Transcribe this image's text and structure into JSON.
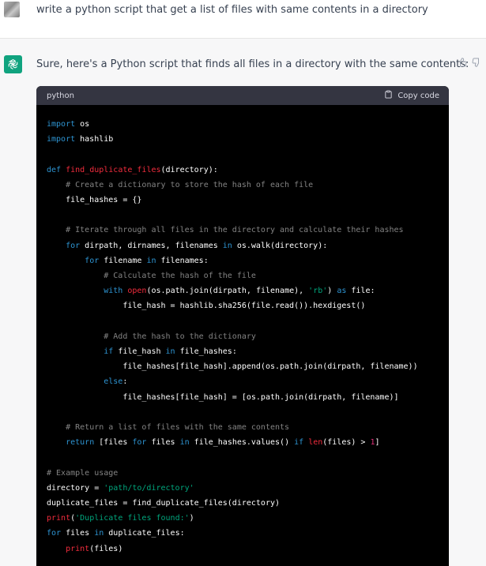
{
  "user_message": {
    "text": "write a python script that get a list of files with same contents in a directory"
  },
  "assistant_message": {
    "intro": "Sure, here's a Python script that finds all files in a directory with the same contents:",
    "icons": [
      "openai-logo-icon",
      "thumbs-up-icon",
      "thumbs-down-icon"
    ]
  },
  "code_block": {
    "language": "python",
    "copy_label": "Copy code",
    "colors": {
      "keyword": "#2e95d3",
      "function": "#f22c3d",
      "string": "#00a67d",
      "number": "#df3079",
      "comment": "#ffffff80",
      "background": "#000000",
      "header": "#343541"
    },
    "lines": [
      [
        [
          "kw",
          "import"
        ],
        [
          "t",
          " os"
        ]
      ],
      [
        [
          "kw",
          "import"
        ],
        [
          "t",
          " hashlib"
        ]
      ],
      [],
      [
        [
          "kw",
          "def"
        ],
        [
          "t",
          " "
        ],
        [
          "fn",
          "find_duplicate_files"
        ],
        [
          "t",
          "(directory):"
        ]
      ],
      [
        [
          "t",
          "    "
        ],
        [
          "cm",
          "# Create a dictionary to store the hash of each file"
        ]
      ],
      [
        [
          "t",
          "    file_hashes = {}"
        ]
      ],
      [],
      [
        [
          "t",
          "    "
        ],
        [
          "cm",
          "# Iterate through all files in the directory and calculate their hashes"
        ]
      ],
      [
        [
          "t",
          "    "
        ],
        [
          "kw",
          "for"
        ],
        [
          "t",
          " dirpath, dirnames, filenames "
        ],
        [
          "kw",
          "in"
        ],
        [
          "t",
          " os.walk(directory):"
        ]
      ],
      [
        [
          "t",
          "        "
        ],
        [
          "kw",
          "for"
        ],
        [
          "t",
          " filename "
        ],
        [
          "kw",
          "in"
        ],
        [
          "t",
          " filenames:"
        ]
      ],
      [
        [
          "t",
          "            "
        ],
        [
          "cm",
          "# Calculate the hash of the file"
        ]
      ],
      [
        [
          "t",
          "            "
        ],
        [
          "kw",
          "with"
        ],
        [
          "t",
          " "
        ],
        [
          "fn",
          "open"
        ],
        [
          "t",
          "(os.path.join(dirpath, filename), "
        ],
        [
          "st",
          "'rb'"
        ],
        [
          "t",
          ") "
        ],
        [
          "kw",
          "as"
        ],
        [
          "t",
          " file:"
        ]
      ],
      [
        [
          "t",
          "                file_hash = hashlib.sha256(file.read()).hexdigest()"
        ]
      ],
      [],
      [
        [
          "t",
          "            "
        ],
        [
          "cm",
          "# Add the hash to the dictionary"
        ]
      ],
      [
        [
          "t",
          "            "
        ],
        [
          "kw",
          "if"
        ],
        [
          "t",
          " file_hash "
        ],
        [
          "kw",
          "in"
        ],
        [
          "t",
          " file_hashes:"
        ]
      ],
      [
        [
          "t",
          "                file_hashes[file_hash].append(os.path.join(dirpath, filename))"
        ]
      ],
      [
        [
          "t",
          "            "
        ],
        [
          "kw",
          "else"
        ],
        [
          "t",
          ":"
        ]
      ],
      [
        [
          "t",
          "                file_hashes[file_hash] = [os.path.join(dirpath, filename)]"
        ]
      ],
      [],
      [
        [
          "t",
          "    "
        ],
        [
          "cm",
          "# Return a list of files with the same contents"
        ]
      ],
      [
        [
          "t",
          "    "
        ],
        [
          "kw",
          "return"
        ],
        [
          "t",
          " [files "
        ],
        [
          "kw",
          "for"
        ],
        [
          "t",
          " files "
        ],
        [
          "kw",
          "in"
        ],
        [
          "t",
          " file_hashes.values() "
        ],
        [
          "kw",
          "if"
        ],
        [
          "t",
          " "
        ],
        [
          "fn",
          "len"
        ],
        [
          "t",
          "(files) > "
        ],
        [
          "nu",
          "1"
        ],
        [
          "t",
          "]"
        ]
      ],
      [],
      [
        [
          "cm",
          "# Example usage"
        ]
      ],
      [
        [
          "t",
          "directory = "
        ],
        [
          "st",
          "'path/to/directory'"
        ]
      ],
      [
        [
          "t",
          "duplicate_files = find_duplicate_files(directory)"
        ]
      ],
      [
        [
          "fn",
          "print"
        ],
        [
          "t",
          "("
        ],
        [
          "st",
          "'Duplicate files found:'"
        ],
        [
          "t",
          ")"
        ]
      ],
      [
        [
          "kw",
          "for"
        ],
        [
          "t",
          " files "
        ],
        [
          "kw",
          "in"
        ],
        [
          "t",
          " duplicate_files:"
        ]
      ],
      [
        [
          "t",
          "    "
        ],
        [
          "fn",
          "print"
        ],
        [
          "t",
          "(files)"
        ]
      ]
    ]
  }
}
